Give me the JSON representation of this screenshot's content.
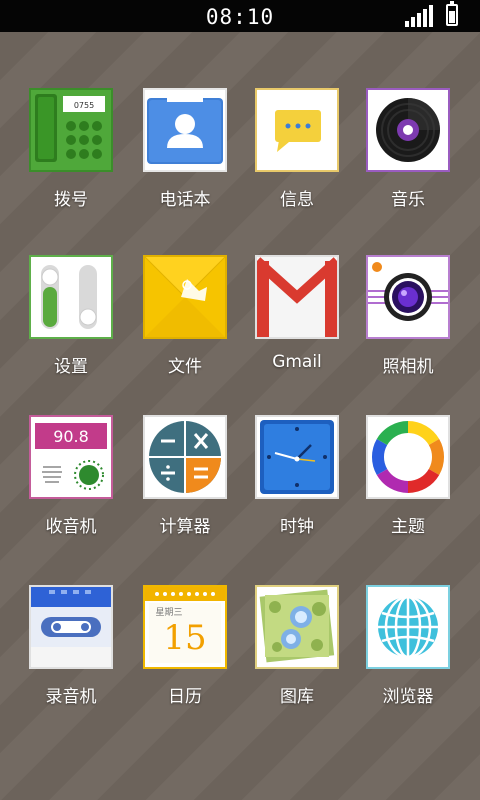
{
  "status_bar": {
    "time": "08:10",
    "signal_icon": "signal-bars-icon",
    "battery_icon": "battery-icon"
  },
  "apps": [
    {
      "label": "拨号",
      "icon": "phone-icon"
    },
    {
      "label": "电话本",
      "icon": "contacts-icon"
    },
    {
      "label": "信息",
      "icon": "message-bubble-icon"
    },
    {
      "label": "音乐",
      "icon": "vinyl-record-icon"
    },
    {
      "label": "设置",
      "icon": "toggle-switch-icon"
    },
    {
      "label": "文件",
      "icon": "envelope-icon"
    },
    {
      "label": "Gmail",
      "icon": "gmail-m-icon"
    },
    {
      "label": "照相机",
      "icon": "camera-lens-icon"
    },
    {
      "label": "收音机",
      "icon": "radio-icon",
      "frequency": "90.8"
    },
    {
      "label": "计算器",
      "icon": "calculator-icon"
    },
    {
      "label": "时钟",
      "icon": "clock-icon"
    },
    {
      "label": "主题",
      "icon": "color-wheel-icon"
    },
    {
      "label": "录音机",
      "icon": "cassette-icon"
    },
    {
      "label": "日历",
      "icon": "calendar-icon",
      "weekday": "星期三",
      "day": "15"
    },
    {
      "label": "图库",
      "icon": "photo-icon"
    },
    {
      "label": "浏览器",
      "icon": "globe-icon"
    }
  ]
}
